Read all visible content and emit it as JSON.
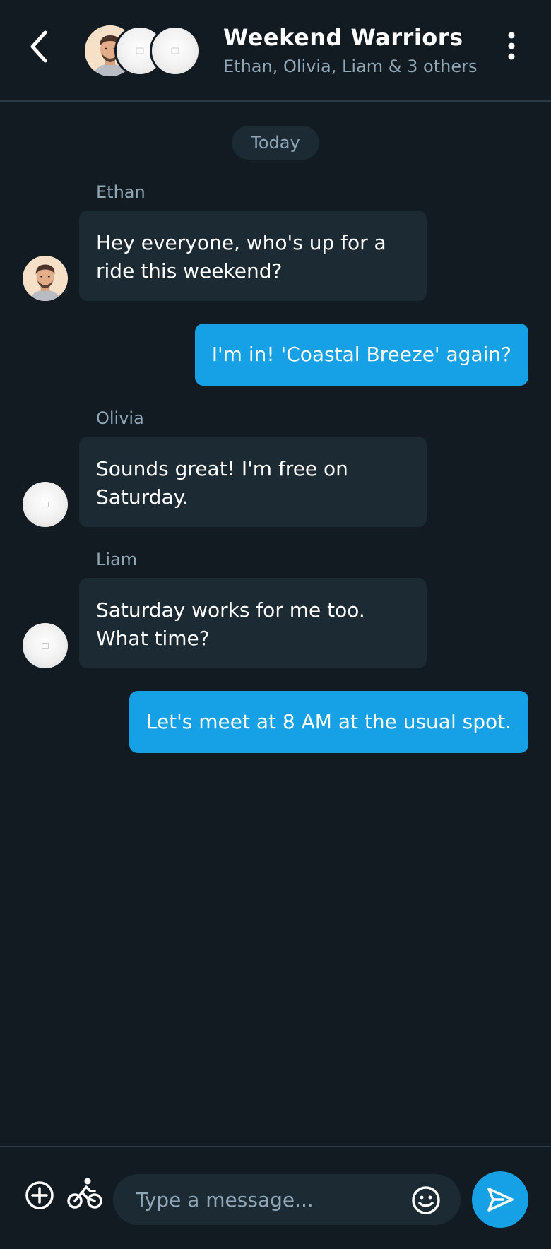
{
  "header": {
    "title": "Weekend Warriors",
    "subtitle": "Ethan, Olivia, Liam & 3 others",
    "back_icon": "chevron-left-icon",
    "more_icon": "more-vertical-icon"
  },
  "date_divider": "Today",
  "messages": [
    {
      "direction": "incoming",
      "sender": "Ethan",
      "text": "Hey everyone, who's up for a ride this weekend?"
    },
    {
      "direction": "outgoing",
      "text": "I'm in! 'Coastal Breeze' again?"
    },
    {
      "direction": "incoming",
      "sender": "Olivia",
      "text": "Sounds great! I'm free on Saturday."
    },
    {
      "direction": "incoming",
      "sender": "Liam",
      "text": "Saturday works for me too. What time?"
    },
    {
      "direction": "outgoing",
      "text": "Let's meet at 8 AM at the usual spot."
    }
  ],
  "composer": {
    "placeholder": "Type a message...",
    "add_icon": "plus-circle-icon",
    "bike_icon": "bicycle-icon",
    "emoji_icon": "smiley-icon",
    "send_icon": "send-icon"
  },
  "colors": {
    "background": "#121b22",
    "incoming_bubble": "#1c2a33",
    "outgoing_bubble": "#16a0e6",
    "muted_text": "#8fa7b6"
  }
}
